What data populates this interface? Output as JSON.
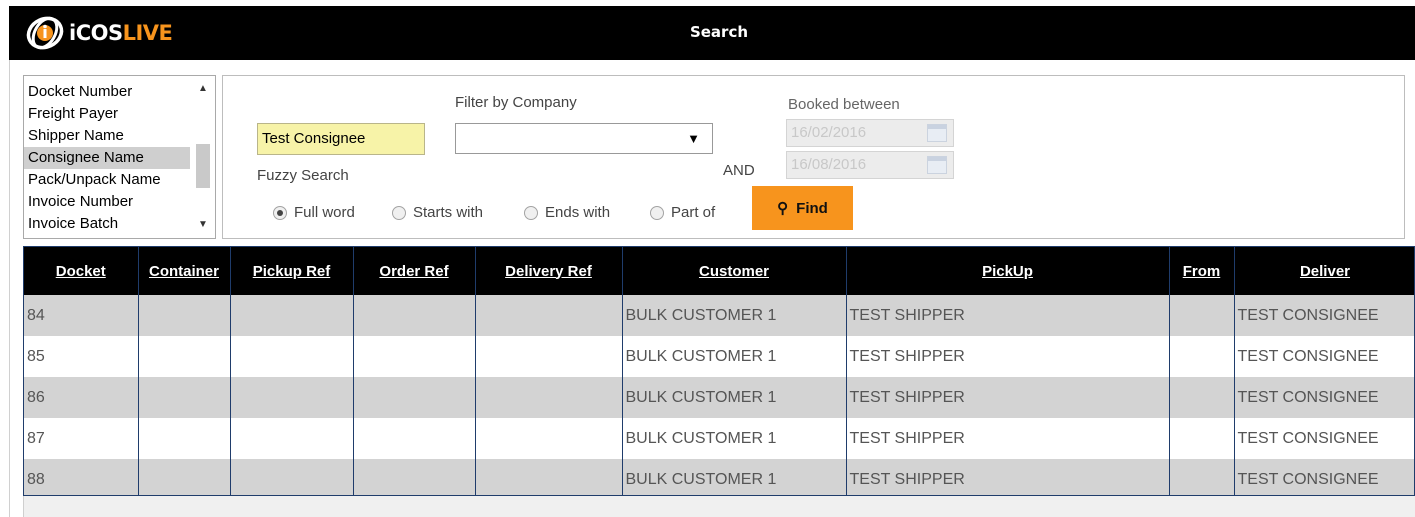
{
  "header": {
    "logo_text_a": "iCOS",
    "logo_text_b": "LIVE",
    "title": "Search"
  },
  "field_list": {
    "items": [
      "Docket Number",
      "Freight Payer",
      "Shipper Name",
      "Consignee Name",
      "Pack/Unpack Name",
      "Invoice Number",
      "Invoice Batch"
    ],
    "selected": "Consignee Name"
  },
  "search": {
    "value": "Test Consignee",
    "fuzzy_label": "Fuzzy Search",
    "filter_company_label": "Filter by Company",
    "company_value": "",
    "booked_between_label": "Booked between",
    "date_from": "16/02/2016",
    "date_to": "16/08/2016",
    "and_label": "AND",
    "options": [
      "Full word",
      "Starts with",
      "Ends with",
      "Part of"
    ],
    "selected_option": "Full word",
    "find_label": "Find"
  },
  "table": {
    "columns": [
      "Docket",
      "Container",
      "Pickup Ref",
      "Order Ref",
      "Delivery Ref",
      "Customer",
      "PickUp",
      "From",
      "Deliver"
    ],
    "rows": [
      [
        "84",
        "",
        "",
        "",
        "",
        "BULK CUSTOMER 1",
        "TEST SHIPPER",
        "",
        "TEST CONSIGNEE"
      ],
      [
        "85",
        "",
        "",
        "",
        "",
        "BULK CUSTOMER 1",
        "TEST SHIPPER",
        "",
        "TEST CONSIGNEE"
      ],
      [
        "86",
        "",
        "",
        "",
        "",
        "BULK CUSTOMER 1",
        "TEST SHIPPER",
        "",
        "TEST CONSIGNEE"
      ],
      [
        "87",
        "",
        "",
        "",
        "",
        "BULK CUSTOMER 1",
        "TEST SHIPPER",
        "",
        "TEST CONSIGNEE"
      ],
      [
        "88",
        "",
        "",
        "",
        "",
        "BULK CUSTOMER 1",
        "TEST SHIPPER",
        "",
        "TEST CONSIGNEE"
      ]
    ]
  },
  "colors": {
    "brand_orange": "#f7941d",
    "header_black": "#000000",
    "row_stripe": "#d3d3d3",
    "input_highlight": "#f7f3a8"
  }
}
